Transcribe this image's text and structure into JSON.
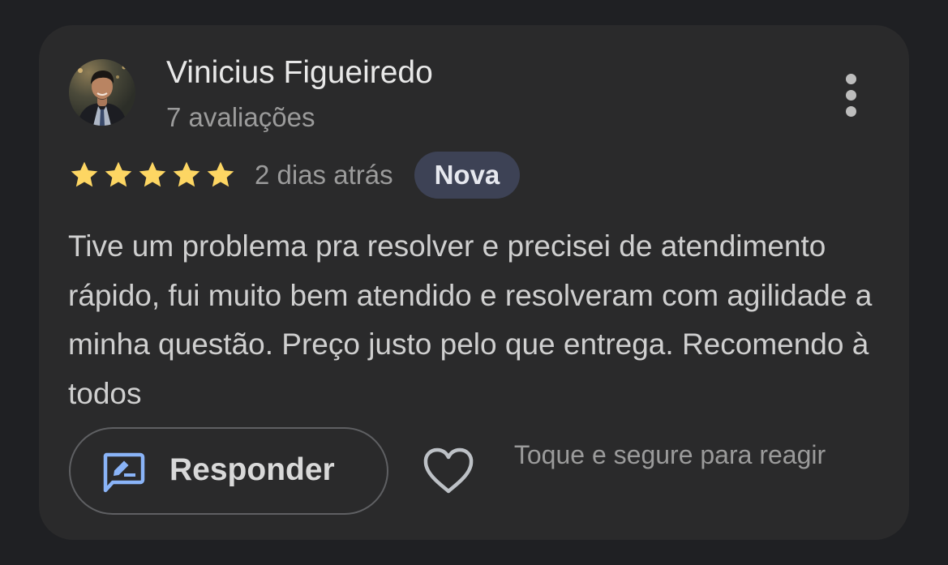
{
  "review": {
    "reviewer_name": "Vinicius Figueiredo",
    "reviewer_review_count": "7 avaliações",
    "rating": 5,
    "rating_max": 5,
    "date": "2 dias atrás",
    "badge": "Nova",
    "text": "Tive um problema pra resolver e precisei de atendimento rápido, fui muito bem atendido e resolveram com agilidade a minha questão. Preço justo pelo que entrega. Recomendo à todos"
  },
  "actions": {
    "reply_label": "Responder",
    "react_hint": "Toque e segure para reagir"
  },
  "icons": {
    "avatar": "reviewer-photo",
    "more": "more-vert-icon",
    "star": "star-icon",
    "reply": "rate-review-icon",
    "like": "heart-outline-icon"
  },
  "colors": {
    "background": "#1f2023",
    "card": "#2a2a2b",
    "star": "#fdd663",
    "badge_bg": "#3d4255",
    "reply_icon": "#8ab4f8"
  }
}
